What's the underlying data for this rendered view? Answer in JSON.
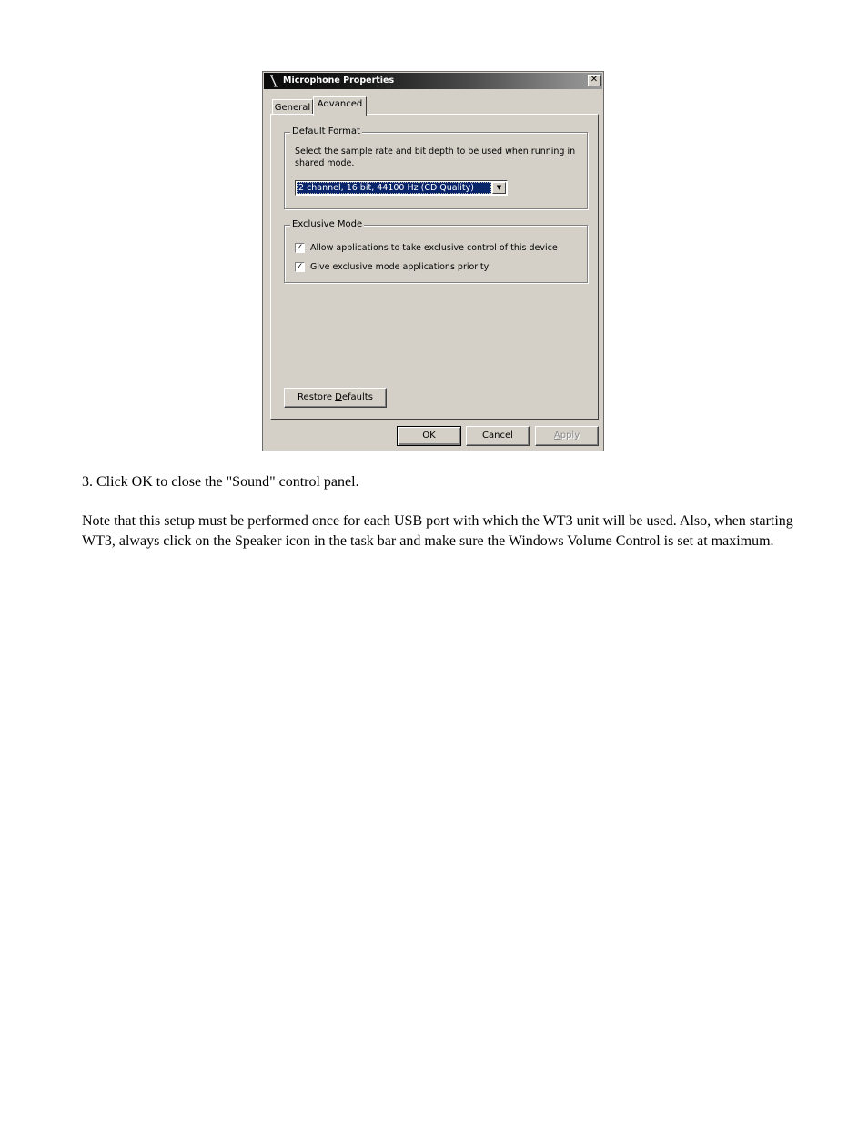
{
  "dialog": {
    "title": "Microphone Properties",
    "title_icon": "microphone-icon",
    "close_icon": "close-icon",
    "close_glyph": "✕",
    "tabs": [
      {
        "label": "General",
        "active": false
      },
      {
        "label": "Advanced",
        "active": true
      }
    ],
    "default_format": {
      "group_label": "Default Format",
      "description": "Select the sample rate and bit depth to be used when running in shared mode.",
      "selected_value": "2 channel, 16 bit, 44100 Hz (CD Quality)",
      "dropdown_icon": "chevron-down-icon",
      "dropdown_glyph": "▼"
    },
    "exclusive_mode": {
      "group_label": "Exclusive Mode",
      "options": [
        {
          "label": "Allow applications to take exclusive control of this device",
          "checked": true
        },
        {
          "label": "Give exclusive mode applications priority",
          "checked": true
        }
      ],
      "check_glyph": "✓"
    },
    "buttons": {
      "restore_prefix": "Restore ",
      "restore_accel": "D",
      "restore_suffix": "efaults",
      "ok": "OK",
      "cancel": "Cancel",
      "apply_accel": "A",
      "apply_suffix": "pply",
      "apply_enabled": false
    }
  },
  "document": {
    "step": "3. Click OK to close the \"Sound\" control panel.",
    "note": "Note that this setup must be performed once for each USB port with which the WT3 unit will be used. Also, when starting WT3, always click on the Speaker icon in the task bar and make sure the Windows Volume Control is set at maximum."
  }
}
